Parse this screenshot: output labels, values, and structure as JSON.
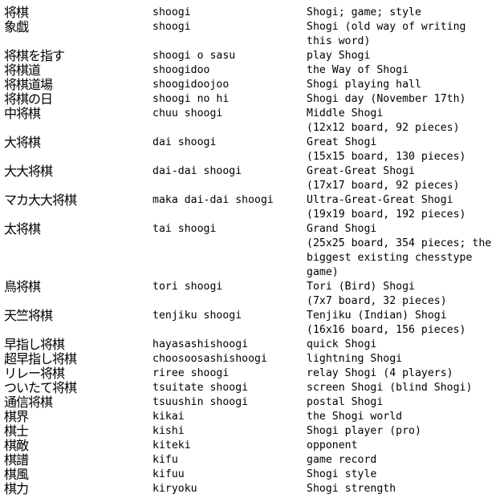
{
  "entries": [
    {
      "kanji": "将棋",
      "romaji": "shoogi",
      "meaning": [
        "Shogi; game; style"
      ]
    },
    {
      "kanji": "象戯",
      "romaji": "shoogi",
      "meaning": [
        "Shogi (old way of writing",
        "this word)"
      ]
    },
    {
      "kanji": "将棋を指す",
      "romaji": "shoogi o sasu",
      "meaning": [
        "play Shogi"
      ]
    },
    {
      "kanji": "将棋道",
      "romaji": "shoogidoo",
      "meaning": [
        "the Way of Shogi"
      ]
    },
    {
      "kanji": "将棋道場",
      "romaji": "shoogidoojoo",
      "meaning": [
        "Shogi playing hall"
      ]
    },
    {
      "kanji": "将棋の日",
      "romaji": "shoogi no hi",
      "meaning": [
        "Shogi day (November 17th)"
      ]
    },
    {
      "kanji": "中将棋",
      "romaji": "chuu shoogi",
      "meaning": [
        "Middle Shogi",
        "(12x12 board, 92 pieces)"
      ]
    },
    {
      "kanji": "大将棋",
      "romaji": "dai shoogi",
      "meaning": [
        "Great Shogi",
        "(15x15 board, 130 pieces)"
      ]
    },
    {
      "kanji": "大大将棋",
      "romaji": "dai-dai shoogi",
      "meaning": [
        "Great-Great Shogi",
        "(17x17 board, 92 pieces)"
      ]
    },
    {
      "kanji": "マカ大大将棋",
      "romaji": "maka dai-dai shoogi",
      "meaning": [
        "Ultra-Great-Great Shogi",
        "(19x19 board, 192 pieces)"
      ]
    },
    {
      "kanji": "太将棋",
      "romaji": "tai shoogi",
      "meaning": [
        "Grand Shogi",
        "(25x25 board, 354 pieces; the",
        "biggest existing chesstype",
        "game)"
      ]
    },
    {
      "kanji": "鳥将棋",
      "romaji": "tori shoogi",
      "meaning": [
        "Tori (Bird) Shogi",
        "(7x7 board, 32 pieces)"
      ]
    },
    {
      "kanji": "天竺将棋",
      "romaji": "tenjiku shoogi",
      "meaning": [
        "Tenjiku (Indian) Shogi",
        "(16x16 board, 156 pieces)"
      ]
    },
    {
      "kanji": "早指し将棋",
      "romaji": "hayasashishoogi",
      "meaning": [
        "quick Shogi"
      ]
    },
    {
      "kanji": "超早指し将棋",
      "romaji": "choosoosashishoogi",
      "meaning": [
        "lightning Shogi"
      ]
    },
    {
      "kanji": "リレー将棋",
      "romaji": "riree shoogi",
      "meaning": [
        "relay Shogi (4 players)"
      ]
    },
    {
      "kanji": "ついたて将棋",
      "romaji": "tsuitate shoogi",
      "meaning": [
        "screen Shogi (blind Shogi)"
      ]
    },
    {
      "kanji": "通信将棋",
      "romaji": "tsuushin shoogi",
      "meaning": [
        "postal Shogi"
      ]
    },
    {
      "kanji": "棋界",
      "romaji": "kikai",
      "meaning": [
        "the Shogi world"
      ]
    },
    {
      "kanji": "棋士",
      "romaji": "kishi",
      "meaning": [
        "Shogi player (pro)"
      ]
    },
    {
      "kanji": "棋敵",
      "romaji": "kiteki",
      "meaning": [
        "opponent"
      ]
    },
    {
      "kanji": "棋譜",
      "romaji": "kifu",
      "meaning": [
        "game record"
      ]
    },
    {
      "kanji": "棋風",
      "romaji": "kifuu",
      "meaning": [
        "Shogi style"
      ]
    },
    {
      "kanji": "棋力",
      "romaji": "kiryoku",
      "meaning": [
        "Shogi strength"
      ]
    }
  ]
}
